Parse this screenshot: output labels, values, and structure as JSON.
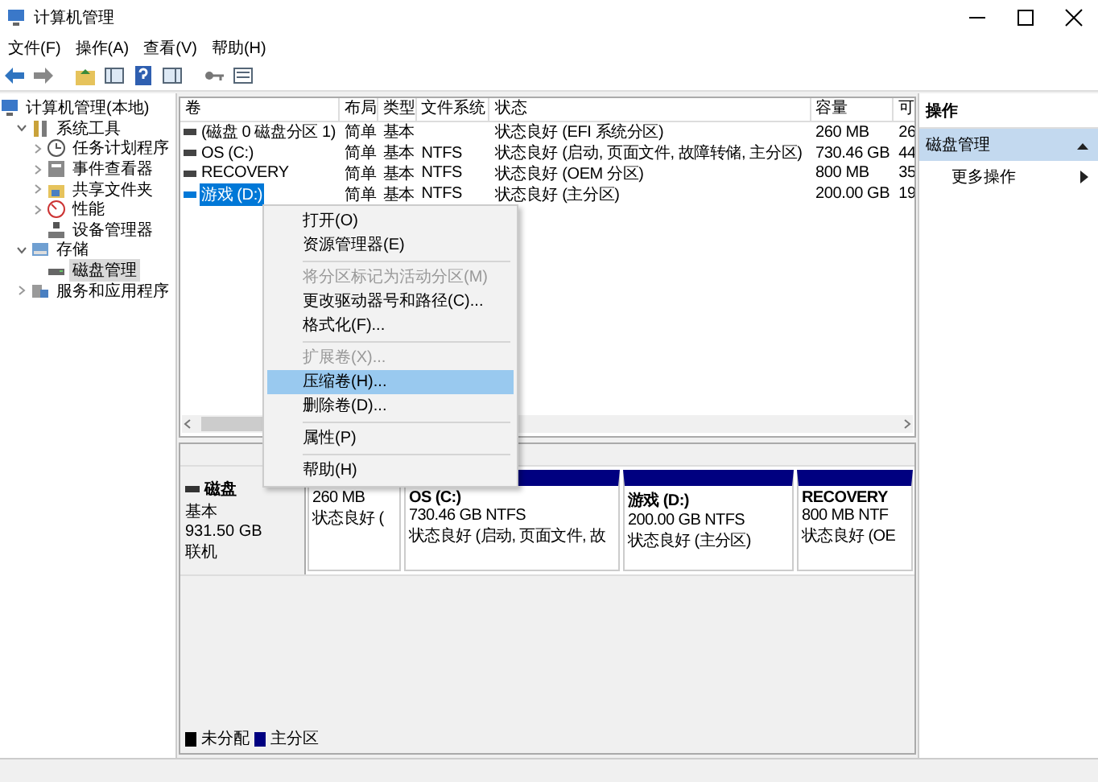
{
  "window": {
    "title": "计算机管理"
  },
  "menu_bar": [
    "文件(F)",
    "操作(A)",
    "查看(V)",
    "帮助(H)"
  ],
  "tree": [
    {
      "label": "计算机管理(本地)",
      "selected": false,
      "children": [
        {
          "label": "系统工具",
          "selected": false,
          "expanded": true,
          "children": [
            {
              "label": "任务计划程序",
              "selected": false,
              "expanded": false
            },
            {
              "label": "事件查看器",
              "selected": false,
              "expanded": false
            },
            {
              "label": "共享文件夹",
              "selected": false,
              "expanded": false
            },
            {
              "label": "性能",
              "selected": false,
              "expanded": false
            },
            {
              "label": "设备管理器",
              "selected": false
            }
          ]
        },
        {
          "label": "存储",
          "selected": false,
          "expanded": true,
          "children": [
            {
              "label": "磁盘管理",
              "selected": true
            }
          ]
        },
        {
          "label": "服务和应用程序",
          "selected": false,
          "expanded": false
        }
      ]
    }
  ],
  "table": {
    "columns": [
      "卷",
      "布局",
      "类型",
      "文件系统",
      "状态",
      "容量",
      "可"
    ],
    "rows": [
      {
        "volume": "(磁盘 0 磁盘分区 1)",
        "layout": "简单",
        "type": "基本",
        "status": "状态良好 (EFI 系统分区)",
        "capacity": "260 MB",
        "column_7": "26",
        "selected": false
      },
      {
        "volume": "OS (C:)",
        "layout": "简单",
        "type": "基本",
        "file_system": "NTFS",
        "status": "状态良好 (启动, 页面文件, 故障转储, 主分区)",
        "capacity": "730.46 GB",
        "column_7": "44",
        "selected": false
      },
      {
        "volume": "RECOVERY",
        "layout": "简单",
        "type": "基本",
        "file_system": "NTFS",
        "status": "状态良好 (OEM 分区)",
        "capacity": "800 MB",
        "column_7": "35",
        "selected": false
      },
      {
        "volume": "游戏 (D:)",
        "layout": "简单",
        "type": "基本",
        "file_system": "NTFS",
        "status": "状态良好 (主分区)",
        "capacity": "200.00 GB",
        "column_7": "19",
        "selected": true
      }
    ]
  },
  "context_menu": {
    "items": [
      {
        "kind": "item",
        "label": "打开(O)",
        "disabled": false,
        "selected": false
      },
      {
        "kind": "item",
        "label": "资源管理器(E)",
        "disabled": false,
        "selected": false
      },
      {
        "kind": "separator"
      },
      {
        "kind": "item",
        "label": "将分区标记为活动分区(M)",
        "disabled": true,
        "selected": false
      },
      {
        "kind": "item",
        "label": "更改驱动器号和路径(C)...",
        "disabled": false,
        "selected": false
      },
      {
        "kind": "item",
        "label": "格式化(F)...",
        "disabled": false,
        "selected": false
      },
      {
        "kind": "separator"
      },
      {
        "kind": "item",
        "label": "扩展卷(X)...",
        "disabled": true,
        "selected": false
      },
      {
        "kind": "item",
        "label": "压缩卷(H)...",
        "disabled": false,
        "selected": true
      },
      {
        "kind": "item",
        "label": "删除卷(D)...",
        "disabled": false,
        "selected": false
      },
      {
        "kind": "separator"
      },
      {
        "kind": "item",
        "label": "属性(P)",
        "disabled": false,
        "selected": false
      },
      {
        "kind": "separator"
      },
      {
        "kind": "item",
        "label": "帮助(H)",
        "disabled": false,
        "selected": false
      }
    ]
  },
  "disk_map": {
    "disk": {
      "title": "磁盘",
      "lines": [
        "基本",
        "931.50 GB",
        "联机"
      ]
    },
    "partitions": [
      {
        "lines": [
          "260 MB",
          "状态良好 ("
        ]
      },
      {
        "name": "OS  (C:)",
        "lines": [
          "730.46 GB NTFS",
          "状态良好 (启动, 页面文件, 故"
        ]
      },
      {
        "name": "游戏 (D:)",
        "lines": [
          "200.00 GB NTFS",
          "状态良好 (主分区)"
        ]
      },
      {
        "name": "RECOVERY",
        "lines": [
          "800 MB NTF",
          "状态良好 (OE"
        ]
      }
    ]
  },
  "legend": [
    {
      "label": "未分配",
      "color": "#000000"
    },
    {
      "label": "主分区",
      "color": "#000080"
    }
  ],
  "actions": {
    "title": "操作",
    "items": [
      {
        "kind": "section",
        "label": "磁盘管理",
        "expanded": true
      },
      {
        "kind": "submenu",
        "label": "更多操作"
      }
    ]
  }
}
